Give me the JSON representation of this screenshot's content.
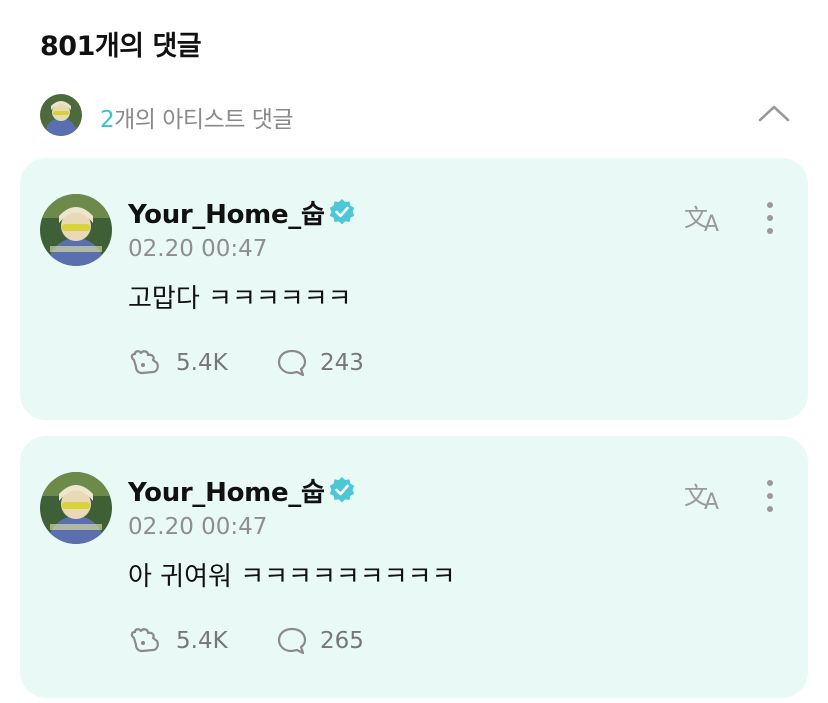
{
  "header": {
    "title": "801개의 댓글"
  },
  "artist_comments": {
    "count": "2",
    "label_suffix": "개의 아티스트 댓글",
    "expanded": true
  },
  "comments": [
    {
      "author": "Your_Home_숩",
      "timestamp": "02.20 00:47",
      "text": "고맙다 ㅋㅋㅋㅋㅋㅋ",
      "likes": "5.4K",
      "replies": "243"
    },
    {
      "author": "Your_Home_숩",
      "timestamp": "02.20 00:47",
      "text": "아 귀여워 ㅋㅋㅋㅋㅋㅋㅋㅋㅋ",
      "likes": "5.4K",
      "replies": "265"
    }
  ],
  "colors": {
    "card_bg": "#e9faf6",
    "accent": "#35c7c7",
    "verified": "#4dc7d6",
    "muted": "#8e8e8e"
  },
  "icons": {
    "verified": "verified-badge-icon",
    "translate": "translate-icon",
    "more": "more-vertical-icon",
    "like": "like-icon",
    "reply": "reply-bubble-icon",
    "collapse": "chevron-up-icon"
  }
}
